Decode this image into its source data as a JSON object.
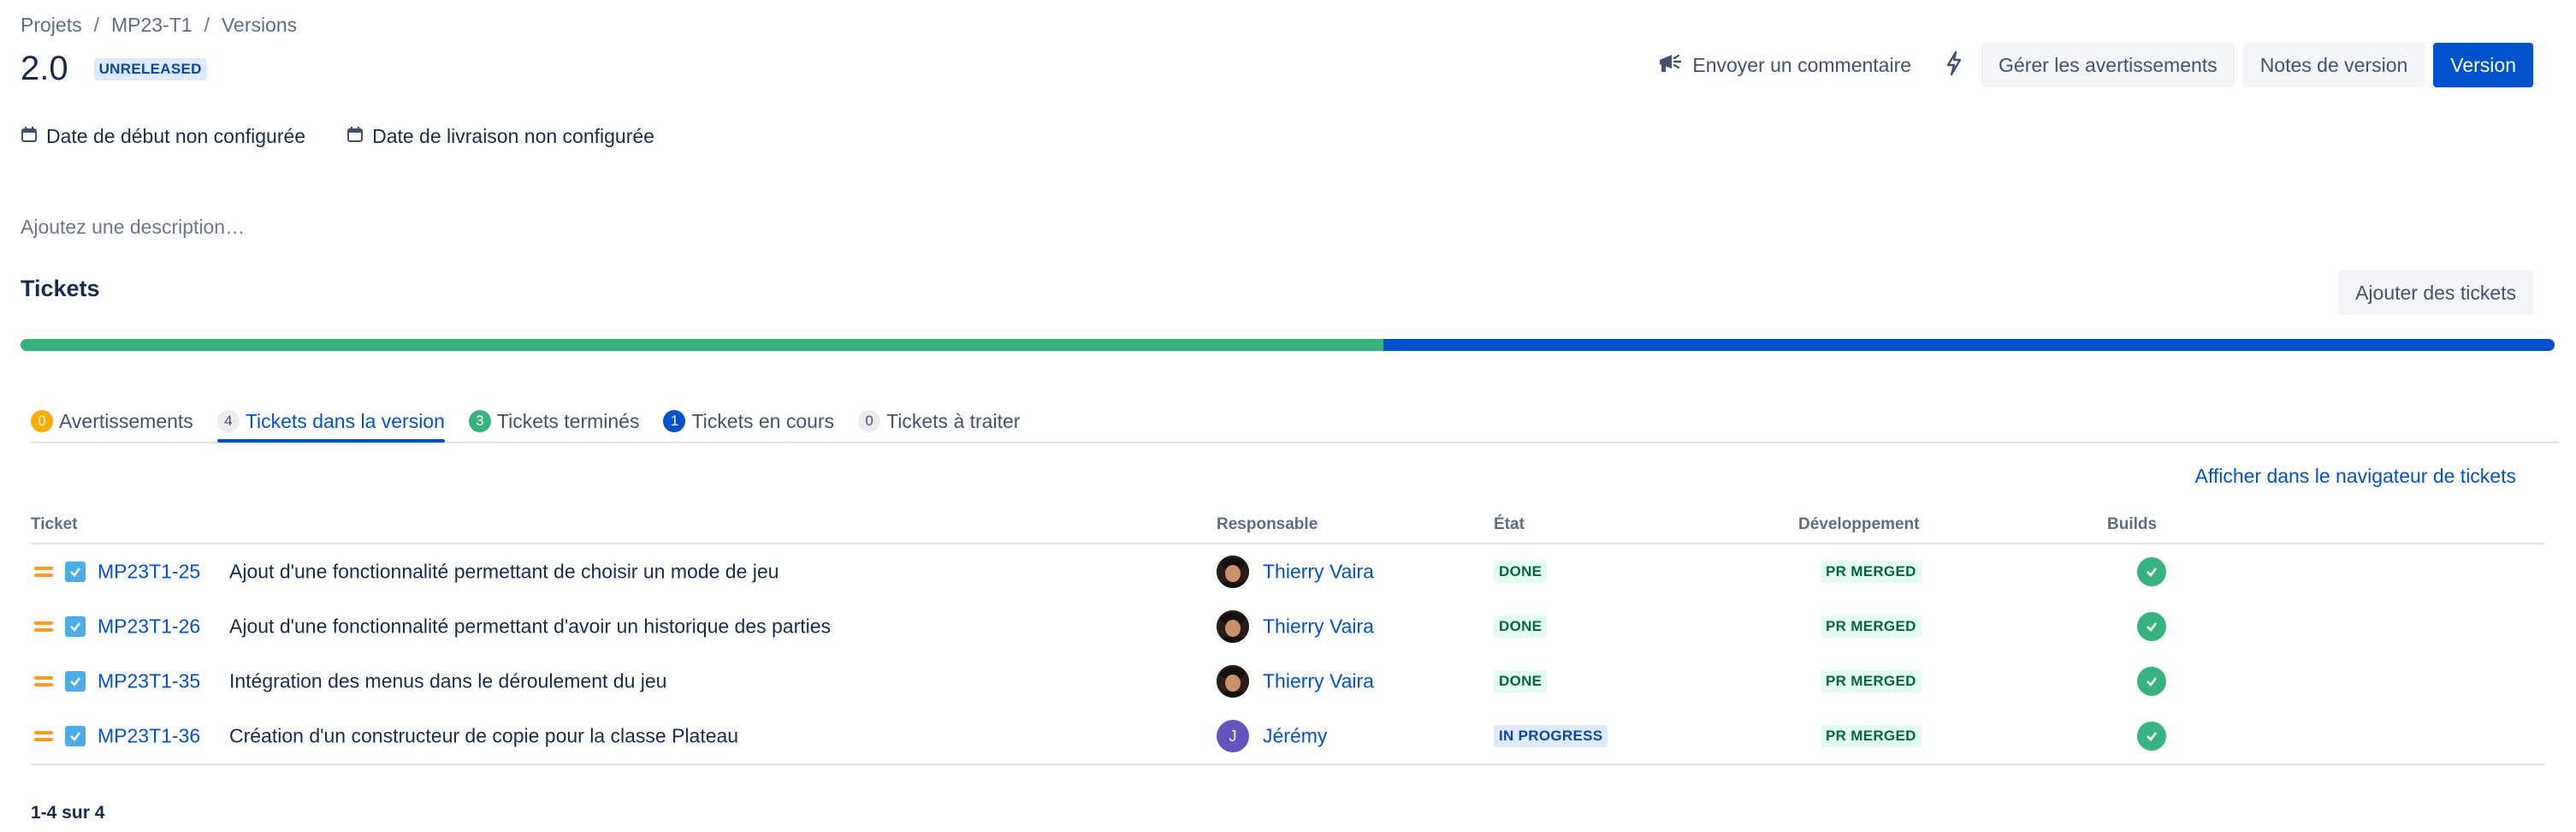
{
  "breadcrumb": {
    "items": [
      "Projets",
      "MP23-T1",
      "Versions"
    ],
    "sep": "/"
  },
  "version": {
    "name": "2.0",
    "status": "UNRELEASED"
  },
  "header": {
    "feedback_label": "Envoyer un commentaire",
    "manage_warnings_label": "Gérer les avertissements",
    "release_notes_label": "Notes de version",
    "release_label": "Version"
  },
  "dates": {
    "start_label": "Date de début non configurée",
    "release_label": "Date de livraison non configurée"
  },
  "description_placeholder": "Ajoutez une description…",
  "tickets_section": {
    "title": "Tickets",
    "add_label": "Ajouter des tickets",
    "progress": {
      "done": 3,
      "in_progress": 1,
      "todo": 0,
      "total": 4
    }
  },
  "tabs": [
    {
      "count": "0",
      "label": "Avertissements"
    },
    {
      "count": "4",
      "label": "Tickets dans la version"
    },
    {
      "count": "3",
      "label": "Tickets terminés"
    },
    {
      "count": "1",
      "label": "Tickets en cours"
    },
    {
      "count": "0",
      "label": "Tickets à traiter"
    }
  ],
  "navigator_link": "Afficher dans le navigateur de tickets",
  "table": {
    "columns": {
      "ticket": "Ticket",
      "assignee": "Responsable",
      "state": "État",
      "dev": "Développement",
      "builds": "Builds"
    },
    "rows": [
      {
        "key": "MP23T1-25",
        "summary": "Ajout d'une fonctionnalité permettant de choisir un mode de jeu",
        "assignee": "Thierry Vaira",
        "state": "DONE",
        "dev": "PR MERGED"
      },
      {
        "key": "MP23T1-26",
        "summary": "Ajout d'une fonctionnalité permettant d'avoir un historique des parties",
        "assignee": "Thierry Vaira",
        "state": "DONE",
        "dev": "PR MERGED"
      },
      {
        "key": "MP23T1-35",
        "summary": "Intégration des menus dans le déroulement du jeu",
        "assignee": "Thierry Vaira",
        "state": "DONE",
        "dev": "PR MERGED"
      },
      {
        "key": "MP23T1-36",
        "summary": "Création d'un constructeur de copie pour la classe Plateau",
        "assignee": "Jérémy",
        "assignee_initial": "J",
        "state": "IN PROGRESS",
        "dev": "PR MERGED"
      }
    ]
  },
  "pagination": "1-4 sur 4",
  "colors": {
    "accent": "#0052CC",
    "done": "#36B37E",
    "warning": "#FFAB00",
    "priority": "#FF991F"
  }
}
